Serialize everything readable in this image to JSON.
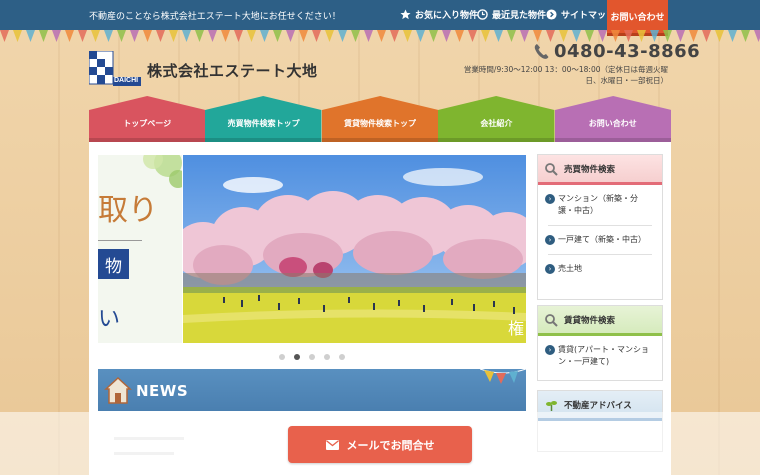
{
  "topbar": {
    "tagline": "不動産のことなら株式会社エステート大地にお任せください！",
    "favorites": "お気に入り物件",
    "recent": "最近見た物件",
    "sitemap": "サイトマップ",
    "contact": "お問い合わせ"
  },
  "header": {
    "logo_text": "DAICHI",
    "company": "株式会社エステート大地",
    "phone": "0480-43-8866",
    "hours_line1": "営業時間/9:30〜12:00 13：00〜18:00（定休日は毎週火曜",
    "hours_line2": "日、水曜日・一部祝日）"
  },
  "nav": {
    "items": [
      {
        "label": "トップページ",
        "color": "#d9545f"
      },
      {
        "label": "売買物件検索トップ",
        "color": "#22a79a"
      },
      {
        "label": "賃貸物件検索トップ",
        "color": "#e0742b"
      },
      {
        "label": "会社紹介",
        "color": "#7fb52f"
      },
      {
        "label": "お問い合わせ",
        "color": "#b86fb4"
      }
    ]
  },
  "slider": {
    "left_big": "取り",
    "left_box": "物",
    "left_small": "い",
    "caption": "権",
    "dots": 5,
    "active_dot": 1
  },
  "news": {
    "title": "NEWS"
  },
  "sidebar": {
    "sale": {
      "title": "売買物件検索",
      "items": [
        "マンション（新築・分譲・中古）",
        "一戸建て（新築・中古）",
        "売土地"
      ]
    },
    "rent": {
      "title": "賃貸物件検索",
      "items": [
        "賃貸(アパート・マンション・一戸建て)"
      ]
    },
    "advice": {
      "title": "不動産アドバイス"
    }
  },
  "mail_button": {
    "label": "メールでお問合せ"
  },
  "colors": {
    "topbar": "#2d5f86",
    "accent": "#e2562d",
    "mail": "#e8614c"
  }
}
